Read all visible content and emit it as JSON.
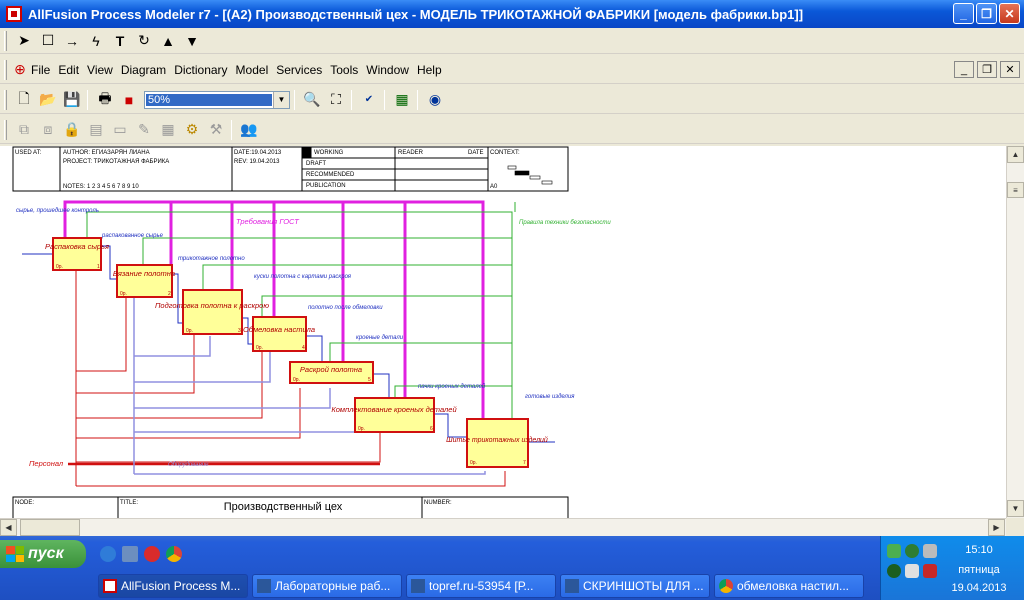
{
  "window": {
    "title": "AllFusion Process Modeler r7 - [(A2) Производственный цех - МОДЕЛЬ ТРИКОТАЖНОЙ ФАБРИКИ  [модель фабрики.bp1]]"
  },
  "menu": [
    "File",
    "Edit",
    "View",
    "Diagram",
    "Dictionary",
    "Model",
    "Services",
    "Tools",
    "Window",
    "Help"
  ],
  "zoom": {
    "value": "50%"
  },
  "frame": {
    "used_at": "USED AT:",
    "author": "AUTHOR:  ЕГИАЗАРЯН ЛИАНА",
    "project": "PROJECT:  ТРИКОТАЖНАЯ ФАБРИКА",
    "date": "DATE:19.04.2013",
    "rev": "REV:  19.04.2013",
    "notes": "NOTES:  1  2  3  4  5  6  7  8  9  10",
    "working": "WORKING",
    "draft": "DRAFT",
    "recommended": "RECOMMENDED",
    "publication": "PUBLICATION",
    "reader": "READER",
    "date2": "DATE",
    "context": "CONTEXT:",
    "node_ref": "A0",
    "node": "NODE:",
    "title_label": "TITLE:",
    "title": "Производственный цех",
    "number": "NUMBER:"
  },
  "activities": [
    {
      "name": "Распаковка сырья",
      "cost": "0р.",
      "num": "1"
    },
    {
      "name": "Вязание полотна",
      "cost": "0р.",
      "num": "2"
    },
    {
      "name": "Подготовка полотна к раскрою",
      "cost": "0р.",
      "num": "3"
    },
    {
      "name": "Обмеловка настила",
      "cost": "0р.",
      "num": "4"
    },
    {
      "name": "Раскрой полотна",
      "cost": "0р.",
      "num": "5"
    },
    {
      "name": "Комплектование кроеных деталей",
      "cost": "0р.",
      "num": "6"
    },
    {
      "name": "Шитье трикотажных изделий",
      "cost": "0р.",
      "num": "7"
    }
  ],
  "arrow_labels": {
    "input": "сырье, прошедшее контроль",
    "unpacked": "распакованное сырье",
    "gost": "Требования ГОСТ",
    "safety": "Правила техники безопасности",
    "knitted": "трикотажное полотно",
    "pieces": "куски полотна с картами раскроя",
    "marked": "полотно после обмеловки",
    "cut": "кроеные детали",
    "packs": "пачки кроеных деталей",
    "finished": "готовые изделия",
    "personnel": "Персонал",
    "equipment": "Оборудование"
  },
  "taskbar": {
    "start": "пуск",
    "tasks": [
      "AllFusion Process M...",
      "Лабораторные раб...",
      "topref.ru-53954 [Р...",
      "СКРИНШОТЫ ДЛЯ ...",
      "обмеловка настил..."
    ],
    "time": "15:10",
    "day": "пятница",
    "date": "19.04.2013"
  },
  "colors": {
    "control": "#e020e0",
    "safety": "#30b030",
    "input": "#2030c0",
    "mechanism_red": "#d01010",
    "mechanism_blue": "#9090e0",
    "box_fill": "#ffff99",
    "box_border": "#d01010"
  }
}
